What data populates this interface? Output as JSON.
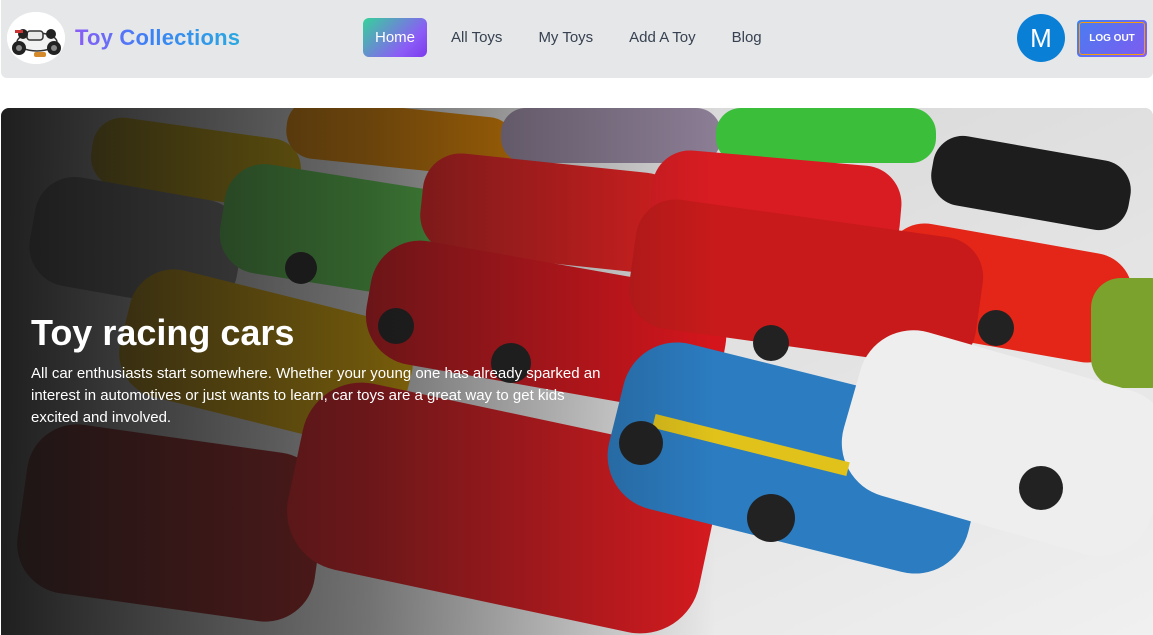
{
  "brand": {
    "name": "Toy Collections",
    "logo_icon": "toy-race-car-icon"
  },
  "nav": {
    "items": [
      {
        "label": "Home",
        "active": true
      },
      {
        "label": "All Toys",
        "active": false
      },
      {
        "label": "My Toys",
        "active": false
      },
      {
        "label": "Add A Toy",
        "active": false
      },
      {
        "label": "Blog",
        "active": false
      }
    ]
  },
  "user": {
    "avatar_initial": "M",
    "logout_label": "LOG OUT"
  },
  "hero": {
    "title": "Toy racing cars",
    "description": "All car enthusiasts start somewhere. Whether your young one has already sparked an interest in automotives or just wants to learn, car toys are a great way to get kids excited and involved.",
    "image_subject": "collection of toy die-cast cars"
  },
  "colors": {
    "navbar_bg": "#e5e7e8",
    "active_gradient_start": "#34d399",
    "active_gradient_end": "#8b5cf6",
    "avatar_bg": "#0a7fd6",
    "brand_gradient_start": "#8b5cf6",
    "brand_gradient_end": "#2aa8e0"
  }
}
